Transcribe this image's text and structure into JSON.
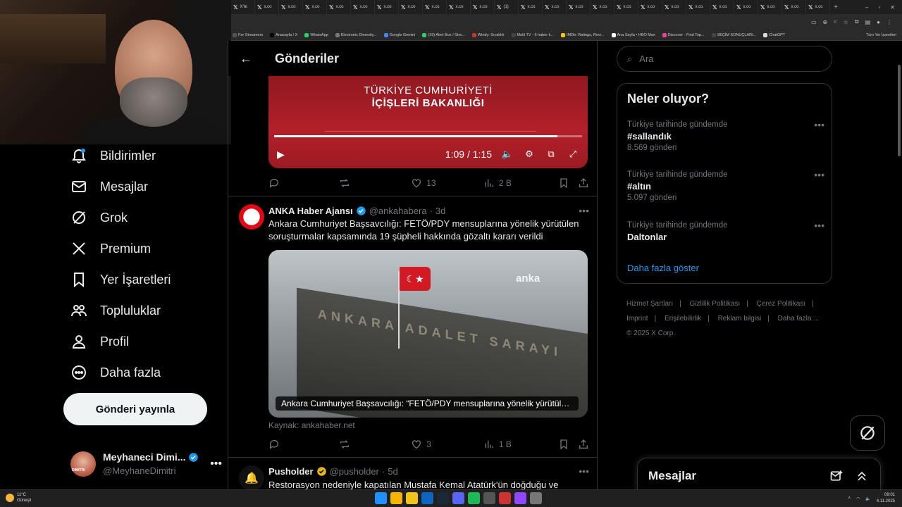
{
  "browser": {
    "tabs": [
      "X’te",
      "x.co",
      "x.co",
      "x.co",
      "x.co",
      "x.co",
      "x.co",
      "x.co",
      "x.co",
      "x.co",
      "x.co",
      "(1) ",
      "x.co",
      "x.co",
      "x.co",
      "x.co",
      "x.co",
      "x.co",
      "x.co",
      "x.co",
      "x.co",
      "x.co",
      "x.co",
      "x.co",
      "x.co"
    ],
    "new_tab": "+",
    "bookmarks": [
      {
        "label": "For Streamers",
        "color": "#555"
      },
      {
        "label": "Anasayfa / X",
        "color": "#000"
      },
      {
        "label": "WhatsApp",
        "color": "#25d366"
      },
      {
        "label": "Electronic Diversity...",
        "color": "#777"
      },
      {
        "label": "Google Gemini",
        "color": "#4285f4"
      },
      {
        "label": "(19) Alert Box / Stre...",
        "color": "#2ecc71"
      },
      {
        "label": "Windy: Sıcaklık",
        "color": "#c0392b"
      },
      {
        "label": "Multi TV - 6 haber k...",
        "color": "#444"
      },
      {
        "label": "IMDb: Ratings, Revi...",
        "color": "#f5c518"
      },
      {
        "label": "Ana Sayfa • HBO Max",
        "color": "#fff"
      },
      {
        "label": "Discover - Find Top...",
        "color": "#e84393"
      },
      {
        "label": "SEÇİM SONUÇLARI...",
        "color": "#444"
      },
      {
        "label": "ChatGPT",
        "color": "#ddd"
      }
    ],
    "all_bookmarks": "Tüm Yer İşaretleri"
  },
  "nav": {
    "items": [
      {
        "label": "Bildirimler",
        "icon": "bell-icon"
      },
      {
        "label": "Mesajlar",
        "icon": "mail-icon"
      },
      {
        "label": "Grok",
        "icon": "grok-icon"
      },
      {
        "label": "Premium",
        "icon": "x-logo-icon"
      },
      {
        "label": "Yer İşaretleri",
        "icon": "bookmark-icon"
      },
      {
        "label": "Topluluklar",
        "icon": "communities-icon"
      },
      {
        "label": "Profil",
        "icon": "person-icon"
      },
      {
        "label": "Daha fazla",
        "icon": "more-circle-icon"
      }
    ],
    "post_button": "Gönderi yayınla",
    "account": {
      "display_name": "Meyhaneci Dimi...",
      "handle": "@MeyhaneDimitri",
      "avatar_text": "DIMITRI"
    }
  },
  "header": {
    "title": "Gönderiler"
  },
  "video_post": {
    "line1": "TÜRKİYE CUMHURİYETİ",
    "line2": "İÇİŞLERİ BAKANLIĞI",
    "time": "1:09 / 1:15",
    "progress": 0.92,
    "replies": "",
    "reposts": "",
    "likes": "13",
    "views": "2 B"
  },
  "anka_post": {
    "name": "ANKA Haber Ajansı",
    "handle": "@ankahabera",
    "age": "3d",
    "text": "Ankara Cumhuriyet Başsavcılığı: FETÖ/PDY mensuplarına yönelik yürütülen soruşturmalar kapsamında 19 şüpheli hakkında gözaltı kararı verildi",
    "watermark": "anka",
    "engraving": "ANKARA ADALET SARAYI",
    "caption": "Ankara Cumhuriyet Başsavcılığı: “FETÖ/PDY mensuplarına yönelik yürütülen s...",
    "source": "Kaynak: ankahaber.net",
    "likes": "3",
    "views": "1 B"
  },
  "pusholder_post": {
    "name": "Pusholder",
    "handle": "@pusholder",
    "age": "5d",
    "text": "Restorasyon nedeniyle kapatılan Mustafa Kemal Atatürk'ün doğduğu ve"
  },
  "right": {
    "search_placeholder": "Ara",
    "trends_title": "Neler oluyor?",
    "trends": [
      {
        "context": "Türkiye tarihinde gündemde",
        "topic": "#sallandık",
        "count": "8.569 gönderi"
      },
      {
        "context": "Türkiye tarihinde gündemde",
        "topic": "#altın",
        "count": "5.097 gönderi"
      },
      {
        "context": "Türkiye tarihinde gündemde",
        "topic": "Daltonlar",
        "count": ""
      }
    ],
    "show_more": "Daha fazla göster",
    "footer": [
      "Hizmet Şartları",
      "|",
      "Gizlilik Politikası",
      "|",
      "Çerez Politikası",
      "|",
      "Imprint",
      "|",
      "Erişilebilirlik",
      "|",
      "Reklam bilgisi",
      "|",
      "Daha fazla ...",
      "© 2025 X Corp."
    ]
  },
  "messages_drawer": {
    "title": "Mesajlar"
  },
  "taskbar": {
    "temp": "11°C",
    "condition": "Güneşli",
    "time": "09:01",
    "date": "4.11.2025"
  },
  "colors": {
    "accent": "#1d9bf0",
    "background": "#000000",
    "border": "#2f3336",
    "muted": "#71767b",
    "verified_blue": "#1d9bf0",
    "verified_gold": "#e2b719"
  }
}
